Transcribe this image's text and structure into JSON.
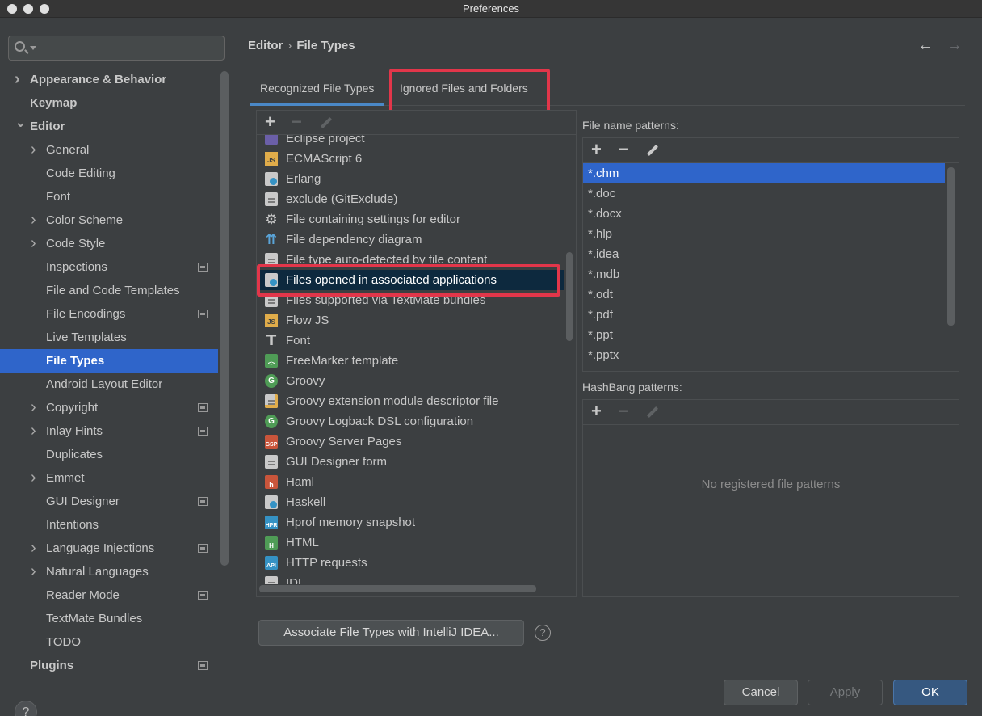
{
  "window": {
    "title": "Preferences"
  },
  "sidebar": {
    "search_placeholder": "",
    "items": [
      {
        "label": "Appearance & Behavior",
        "level": 0,
        "arrow": "right",
        "bold": true,
        "project": false
      },
      {
        "label": "Keymap",
        "level": 0,
        "arrow": "none",
        "bold": true,
        "project": false
      },
      {
        "label": "Editor",
        "level": 0,
        "arrow": "down",
        "bold": true,
        "project": false
      },
      {
        "label": "General",
        "level": 1,
        "arrow": "right",
        "bold": false,
        "project": false
      },
      {
        "label": "Code Editing",
        "level": 1,
        "arrow": "none",
        "bold": false,
        "project": false
      },
      {
        "label": "Font",
        "level": 1,
        "arrow": "none",
        "bold": false,
        "project": false
      },
      {
        "label": "Color Scheme",
        "level": 1,
        "arrow": "right",
        "bold": false,
        "project": false
      },
      {
        "label": "Code Style",
        "level": 1,
        "arrow": "right",
        "bold": false,
        "project": false
      },
      {
        "label": "Inspections",
        "level": 1,
        "arrow": "none",
        "bold": false,
        "project": true
      },
      {
        "label": "File and Code Templates",
        "level": 1,
        "arrow": "none",
        "bold": false,
        "project": false
      },
      {
        "label": "File Encodings",
        "level": 1,
        "arrow": "none",
        "bold": false,
        "project": true
      },
      {
        "label": "Live Templates",
        "level": 1,
        "arrow": "none",
        "bold": false,
        "project": false
      },
      {
        "label": "File Types",
        "level": 1,
        "arrow": "none",
        "bold": true,
        "project": false,
        "selected": true
      },
      {
        "label": "Android Layout Editor",
        "level": 1,
        "arrow": "none",
        "bold": false,
        "project": false
      },
      {
        "label": "Copyright",
        "level": 1,
        "arrow": "right",
        "bold": false,
        "project": true
      },
      {
        "label": "Inlay Hints",
        "level": 1,
        "arrow": "right",
        "bold": false,
        "project": true
      },
      {
        "label": "Duplicates",
        "level": 1,
        "arrow": "none",
        "bold": false,
        "project": false
      },
      {
        "label": "Emmet",
        "level": 1,
        "arrow": "right",
        "bold": false,
        "project": false
      },
      {
        "label": "GUI Designer",
        "level": 1,
        "arrow": "none",
        "bold": false,
        "project": true
      },
      {
        "label": "Intentions",
        "level": 1,
        "arrow": "none",
        "bold": false,
        "project": false
      },
      {
        "label": "Language Injections",
        "level": 1,
        "arrow": "right",
        "bold": false,
        "project": true
      },
      {
        "label": "Natural Languages",
        "level": 1,
        "arrow": "right",
        "bold": false,
        "project": false
      },
      {
        "label": "Reader Mode",
        "level": 1,
        "arrow": "none",
        "bold": false,
        "project": true
      },
      {
        "label": "TextMate Bundles",
        "level": 1,
        "arrow": "none",
        "bold": false,
        "project": false
      },
      {
        "label": "TODO",
        "level": 1,
        "arrow": "none",
        "bold": false,
        "project": false
      },
      {
        "label": "Plugins",
        "level": 0,
        "arrow": "none",
        "bold": true,
        "project": true
      }
    ],
    "help_label": "?"
  },
  "header": {
    "breadcrumb": [
      "Editor",
      "File Types"
    ],
    "back_icon": "←",
    "forward_icon": "→"
  },
  "tabs": [
    {
      "label": "Recognized File Types",
      "active": true
    },
    {
      "label": "Ignored Files and Folders",
      "active": false
    }
  ],
  "toolbar": {
    "add": "+",
    "remove": "−"
  },
  "file_types": [
    {
      "label": "Eclipse project",
      "icon": "eclipse-icon"
    },
    {
      "label": "ECMAScript 6",
      "icon": "js-file-icon"
    },
    {
      "label": "Erlang",
      "icon": "person-file-icon"
    },
    {
      "label": "exclude (GitExclude)",
      "icon": "gitexclude-file-icon"
    },
    {
      "label": "File containing settings for editor",
      "icon": "gear-icon"
    },
    {
      "label": "File dependency diagram",
      "icon": "diagram-icon"
    },
    {
      "label": "File type auto-detected by file content",
      "icon": "text-file-icon"
    },
    {
      "label": "Files opened in associated applications",
      "icon": "person-file-icon",
      "selected": true
    },
    {
      "label": "Files supported via TextMate bundles",
      "icon": "text-file-icon"
    },
    {
      "label": "Flow JS",
      "icon": "js-file-icon"
    },
    {
      "label": "Font",
      "icon": "font-icon"
    },
    {
      "label": "FreeMarker template",
      "icon": "freemarker-icon"
    },
    {
      "label": "Groovy",
      "icon": "groovy-icon"
    },
    {
      "label": "Groovy extension module descriptor file",
      "icon": "chart-file-icon"
    },
    {
      "label": "Groovy Logback DSL configuration",
      "icon": "groovy-icon"
    },
    {
      "label": "Groovy Server Pages",
      "icon": "gsp-icon"
    },
    {
      "label": "GUI Designer form",
      "icon": "form-icon"
    },
    {
      "label": "Haml",
      "icon": "haml-icon"
    },
    {
      "label": "Haskell",
      "icon": "person-file-icon"
    },
    {
      "label": "Hprof memory snapshot",
      "icon": "hprof-icon"
    },
    {
      "label": "HTML",
      "icon": "html-file-icon"
    },
    {
      "label": "HTTP requests",
      "icon": "api-file-icon"
    },
    {
      "label": "IDL",
      "icon": "text-file-icon"
    }
  ],
  "file_name_patterns": {
    "label": "File name patterns:",
    "items": [
      "*.chm",
      "*.doc",
      "*.docx",
      "*.hlp",
      "*.idea",
      "*.mdb",
      "*.odt",
      "*.pdf",
      "*.ppt",
      "*.pptx"
    ],
    "selected_index": 0
  },
  "hashbang_patterns": {
    "label": "HashBang patterns:",
    "empty_text": "No registered file patterns"
  },
  "buttons": {
    "associate": "Associate File Types with IntelliJ IDEA...",
    "help": "?",
    "cancel": "Cancel",
    "apply": "Apply",
    "ok": "OK"
  },
  "colors": {
    "highlight_outline": "#e2364a",
    "selection": "#2f65ca",
    "list_selection": "#0d293e",
    "tab_underline": "#4a88c7"
  }
}
